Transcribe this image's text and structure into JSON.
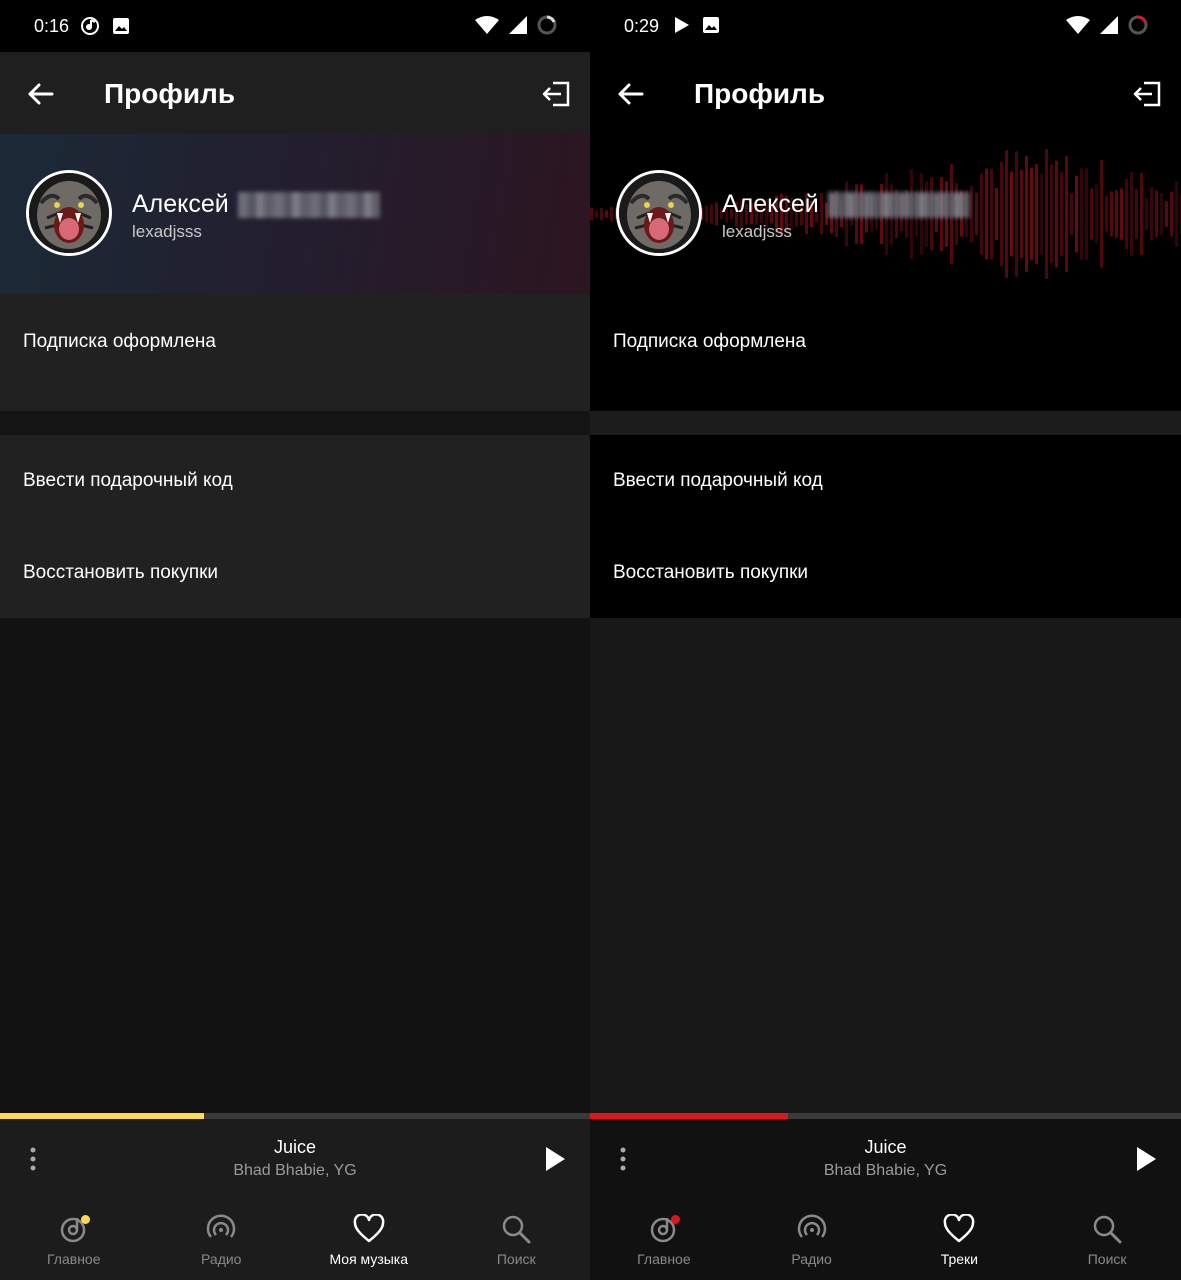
{
  "screens": [
    {
      "status": {
        "time": "0:16"
      },
      "header": {
        "title": "Профиль"
      },
      "profile": {
        "name": "Алексей",
        "login": "lexadjsss"
      },
      "subscription": {
        "text": "Подписка оформлена"
      },
      "menu": [
        {
          "label": "Ввести подарочный код"
        },
        {
          "label": "Восстановить покупки"
        }
      ],
      "player": {
        "title": "Juice",
        "artist": "Bhad Bhabie, YG",
        "progress": 0.345
      },
      "nav": [
        {
          "label": "Главное",
          "icon": "home-disc-icon",
          "badge": true
        },
        {
          "label": "Радио",
          "icon": "radio-icon"
        },
        {
          "label": "Моя музыка",
          "icon": "heart-icon",
          "active": true
        },
        {
          "label": "Поиск",
          "icon": "search-icon"
        }
      ],
      "colors": {
        "accent": "#ffdb4d"
      }
    },
    {
      "status": {
        "time": "0:29"
      },
      "header": {
        "title": "Профиль"
      },
      "profile": {
        "name": "Алексей",
        "login": "lexadjsss"
      },
      "subscription": {
        "text": "Подписка оформлена"
      },
      "menu": [
        {
          "label": "Ввести подарочный код"
        },
        {
          "label": "Восстановить покупки"
        }
      ],
      "player": {
        "title": "Juice",
        "artist": "Bhad Bhabie, YG",
        "progress": 0.335
      },
      "nav": [
        {
          "label": "Главное",
          "icon": "home-disc-icon",
          "badge": true
        },
        {
          "label": "Радио",
          "icon": "radio-icon"
        },
        {
          "label": "Треки",
          "icon": "heart-icon",
          "active": true
        },
        {
          "label": "Поиск",
          "icon": "search-icon"
        }
      ],
      "colors": {
        "accent": "#e0161b"
      }
    }
  ]
}
